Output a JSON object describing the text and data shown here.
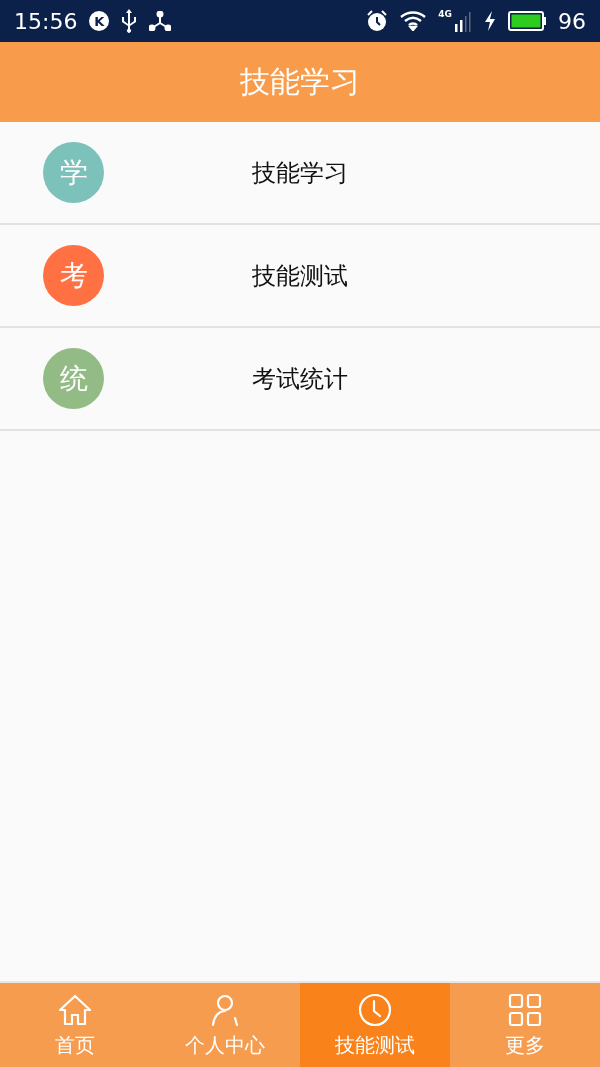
{
  "status_bar": {
    "time": "15:56",
    "badge": "K",
    "network": "4G",
    "battery_level": "96"
  },
  "header": {
    "title": "技能学习"
  },
  "menu": [
    {
      "icon_text": "学",
      "color": "#7cc2ba",
      "label": "技能学习"
    },
    {
      "icon_text": "考",
      "color": "#ff7043",
      "label": "技能测试"
    },
    {
      "icon_text": "统",
      "color": "#93bb85",
      "label": "考试统计"
    }
  ],
  "tabs": [
    {
      "kind": "home",
      "label": "首页",
      "selected": false
    },
    {
      "kind": "person",
      "label": "个人中心",
      "selected": false
    },
    {
      "kind": "clock",
      "label": "技能测试",
      "selected": true
    },
    {
      "kind": "grid",
      "label": "更多",
      "selected": false
    }
  ]
}
